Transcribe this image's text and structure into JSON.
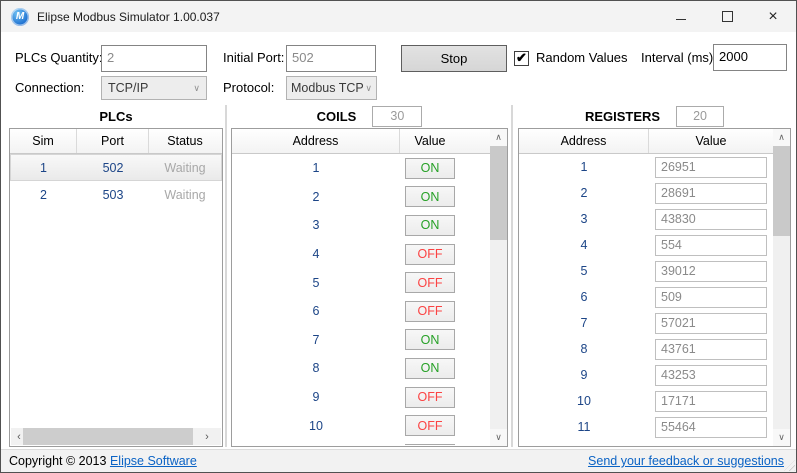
{
  "window": {
    "title": "Elipse Modbus Simulator 1.00.037"
  },
  "icons": {
    "app_logo_letter": "M",
    "minimize": "minimize",
    "maximize": "maximize",
    "close": "×",
    "check": "✔",
    "combo_chevron": "∨",
    "scroll_up": "∧",
    "scroll_down": "∨",
    "scroll_left": "‹",
    "scroll_right": "›"
  },
  "toolbar": {
    "plcs_quantity": {
      "label": "PLCs Quantity:",
      "value": "2"
    },
    "initial_port": {
      "label": "Initial Port:",
      "value": "502"
    },
    "stop_button": "Stop",
    "random_values": {
      "label": "Random Values",
      "checked": true
    },
    "interval": {
      "label": "Interval (ms):",
      "value": "2000"
    },
    "connection": {
      "label": "Connection:",
      "value": "TCP/IP"
    },
    "protocol": {
      "label": "Protocol:",
      "value": "Modbus TCP"
    }
  },
  "plcs": {
    "title": "PLCs",
    "columns": [
      "Sim",
      "Port",
      "Status"
    ],
    "rows": [
      {
        "sim": "1",
        "port": "502",
        "status": "Waiting",
        "selected": true
      },
      {
        "sim": "2",
        "port": "503",
        "status": "Waiting",
        "selected": false
      }
    ]
  },
  "coils": {
    "title": "COILS",
    "count": "30",
    "columns": [
      "Address",
      "Value"
    ],
    "rows": [
      {
        "address": "1",
        "value": "ON"
      },
      {
        "address": "2",
        "value": "ON"
      },
      {
        "address": "3",
        "value": "ON"
      },
      {
        "address": "4",
        "value": "OFF"
      },
      {
        "address": "5",
        "value": "OFF"
      },
      {
        "address": "6",
        "value": "OFF"
      },
      {
        "address": "7",
        "value": "ON"
      },
      {
        "address": "8",
        "value": "ON"
      },
      {
        "address": "9",
        "value": "OFF"
      },
      {
        "address": "10",
        "value": "OFF"
      }
    ],
    "partial_row": {
      "address": "",
      "value": ""
    }
  },
  "registers": {
    "title": "REGISTERS",
    "count": "20",
    "columns": [
      "Address",
      "Value"
    ],
    "rows": [
      {
        "address": "1",
        "value": "26951"
      },
      {
        "address": "2",
        "value": "28691"
      },
      {
        "address": "3",
        "value": "43830"
      },
      {
        "address": "4",
        "value": "554"
      },
      {
        "address": "5",
        "value": "39012"
      },
      {
        "address": "6",
        "value": "509"
      },
      {
        "address": "7",
        "value": "57021"
      },
      {
        "address": "8",
        "value": "43761"
      },
      {
        "address": "9",
        "value": "43253"
      },
      {
        "address": "10",
        "value": "17171"
      },
      {
        "address": "11",
        "value": "55464"
      }
    ]
  },
  "footer": {
    "copyright_text": "Copyright © 2013",
    "copyright_link": "Elipse Software",
    "feedback_link": "Send your feedback or suggestions"
  },
  "colors": {
    "on": "#27a127",
    "off": "#fb4343",
    "navy": "#1c4587",
    "muted": "#a8a8a8",
    "link": "#0b63c5"
  }
}
